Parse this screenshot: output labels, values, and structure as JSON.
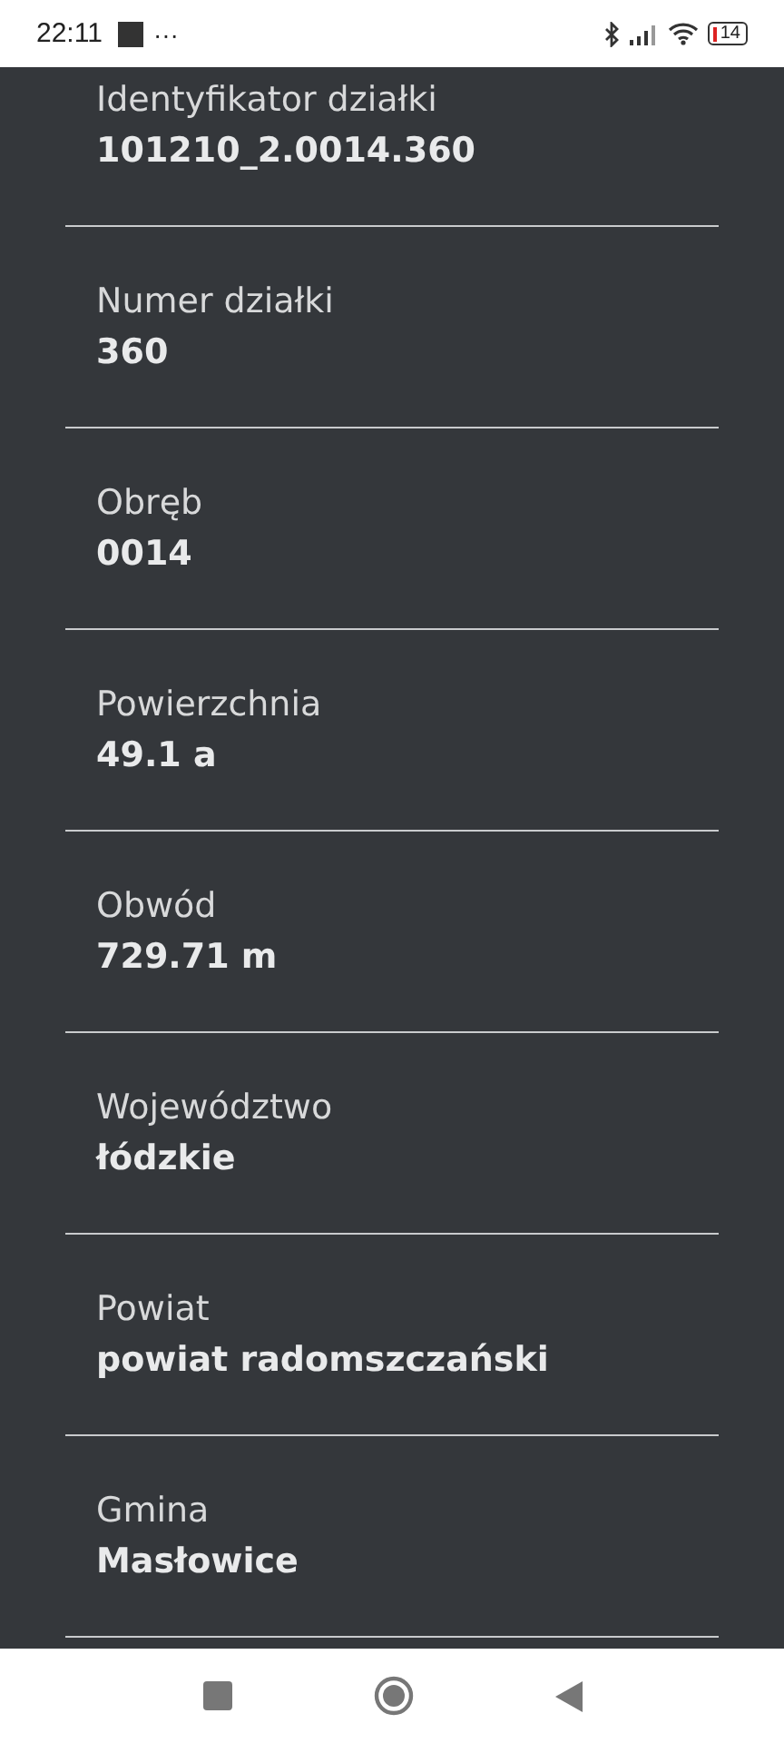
{
  "status_bar": {
    "time": "22:11",
    "overflow": "···",
    "battery": "14"
  },
  "fields": [
    {
      "label": "Identyfikator działki",
      "value": "101210_2.0014.360"
    },
    {
      "label": "Numer działki",
      "value": "360"
    },
    {
      "label": "Obręb",
      "value": "0014"
    },
    {
      "label": "Powierzchnia",
      "value": "49.1 a"
    },
    {
      "label": "Obwód",
      "value": "729.71 m"
    },
    {
      "label": "Województwo",
      "value": "łódzkie"
    },
    {
      "label": "Powiat",
      "value": "powiat radomszczański"
    },
    {
      "label": "Gmina",
      "value": "Masłowice"
    }
  ]
}
